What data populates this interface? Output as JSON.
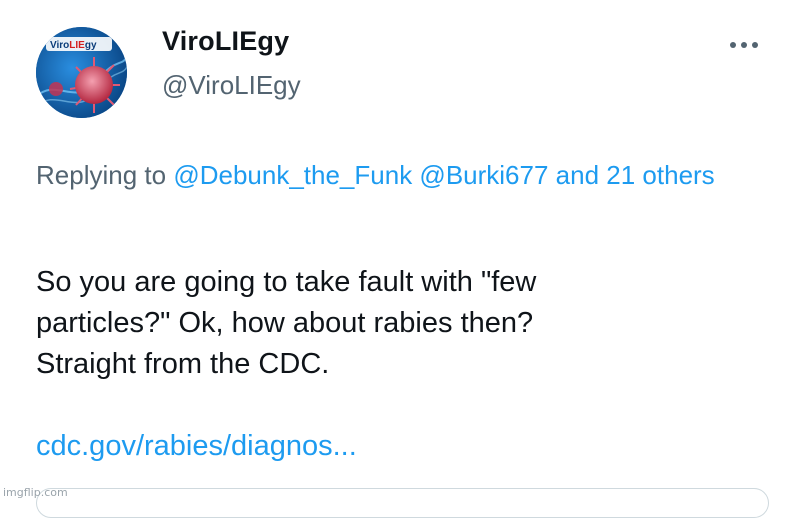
{
  "author": {
    "display_name": "ViroLIEgy",
    "handle": "@ViroLIEgy",
    "avatar_text_a": "Viro",
    "avatar_text_b": "LIE",
    "avatar_text_c": "gy",
    "avatar_icon": "virus-avatar"
  },
  "reply_context": {
    "prefix": "Replying to",
    "mentions": [
      "@Debunk_the_Funk",
      "@Burki677"
    ],
    "others": "and 21 others"
  },
  "tweet": {
    "text": "So you are going to take fault with \"few\nparticles?\" Ok, how about rabies then?\nStraight from the CDC.",
    "link": "cdc.gov/rabies/diagnos..."
  },
  "watermark": "imgflip.com",
  "colors": {
    "link": "#1d9bf0",
    "secondary_text": "#536471",
    "primary_text": "#0f1419"
  }
}
